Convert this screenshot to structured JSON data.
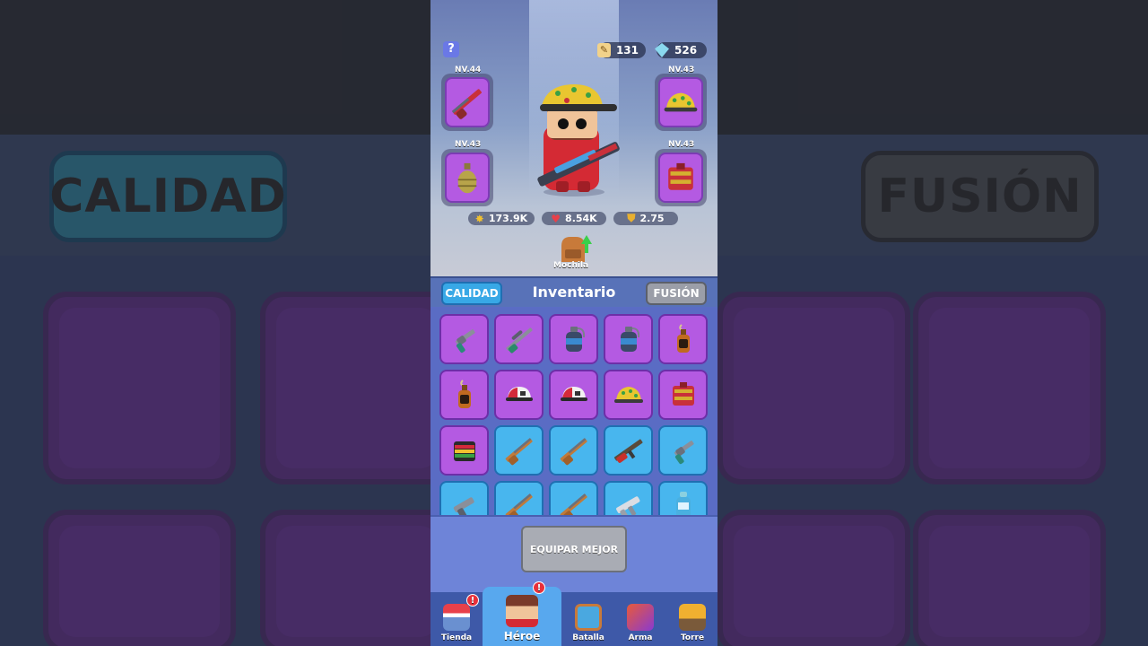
{
  "background": {
    "left_button": "CALIDAD",
    "right_button": "FUSIÓN"
  },
  "resources": {
    "scrolls": "131",
    "gems": "526"
  },
  "equipment": {
    "weapon_level": "NV.44",
    "hat_level": "NV.43",
    "grenade_level": "NV.43",
    "vest_level": "NV.43"
  },
  "stats": {
    "attack": "173.9K",
    "health": "8.54K",
    "defense": "2.75"
  },
  "backpack_label": "Mochila",
  "inventory": {
    "title": "Inventario",
    "quality_tab": "CALIDAD",
    "fusion_tab": "FUSIÓN",
    "items": [
      {
        "icon": "revolver-icon",
        "rarity": "epic"
      },
      {
        "icon": "sniper-icon",
        "rarity": "epic"
      },
      {
        "icon": "grenade-icon",
        "rarity": "epic"
      },
      {
        "icon": "grenade-icon",
        "rarity": "epic"
      },
      {
        "icon": "molotov-icon",
        "rarity": "epic"
      },
      {
        "icon": "molotov-icon",
        "rarity": "epic"
      },
      {
        "icon": "cap-icon",
        "rarity": "epic"
      },
      {
        "icon": "cap-icon",
        "rarity": "epic"
      },
      {
        "icon": "camo-hat-icon",
        "rarity": "epic"
      },
      {
        "icon": "vest-icon",
        "rarity": "epic"
      },
      {
        "icon": "rasta-vest-icon",
        "rarity": "epic"
      },
      {
        "icon": "shotgun-icon",
        "rarity": "rare"
      },
      {
        "icon": "shotgun-icon",
        "rarity": "rare"
      },
      {
        "icon": "rifle-icon",
        "rarity": "rare"
      },
      {
        "icon": "revolver-icon",
        "rarity": "rare"
      },
      {
        "icon": "pistol-icon",
        "rarity": "rare"
      },
      {
        "icon": "shotgun-icon",
        "rarity": "rare"
      },
      {
        "icon": "shotgun-icon",
        "rarity": "rare"
      },
      {
        "icon": "smg-icon",
        "rarity": "rare"
      },
      {
        "icon": "spray-icon",
        "rarity": "rare"
      }
    ]
  },
  "equip_best_button": "EQUIPAR MEJOR",
  "nav": {
    "shop": "Tienda",
    "hero": "Héroe",
    "battle": "Batalla",
    "weapon": "Arma",
    "tower": "Torre",
    "shop_badge": "!",
    "hero_badge": "!"
  }
}
